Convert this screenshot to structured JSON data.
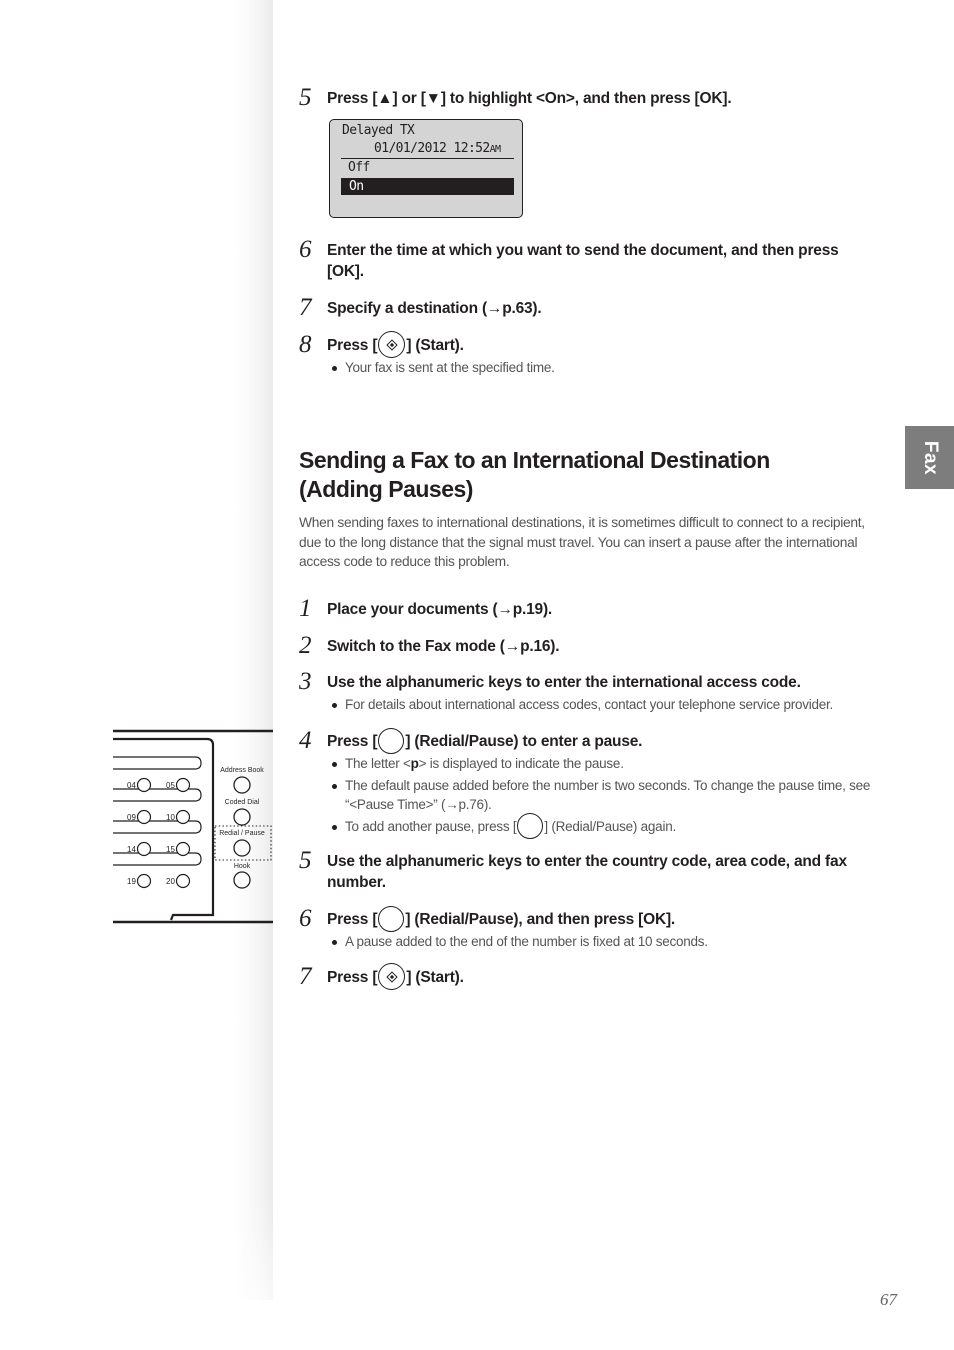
{
  "document": {
    "page_number": "67",
    "side_tab_label": "Fax",
    "colors": {
      "text": "#231f20",
      "body_text": "#555555",
      "tab": "#7d7d7d",
      "lcd_bg": "#d4d4d4"
    }
  },
  "first_steps": [
    {
      "num": "5",
      "text": "Press [▲] or [▼] to highlight <On>, and then press [OK].",
      "bullets": []
    },
    {
      "num": "6",
      "text": "Enter the time at which you want to send the document, and then press [OK].",
      "bullets": []
    },
    {
      "num": "7",
      "text": "Specify a destination (→p.63).",
      "bullets": []
    },
    {
      "num": "8",
      "text_before": "Press [",
      "text_after": "] (Start).",
      "icon": "start-button-icon",
      "bullets": [
        "Your fax is sent at the specified time."
      ]
    }
  ],
  "lcd": {
    "line1": "Delayed TX",
    "line2": "01/01/2012 12:52",
    "line2_suffix": "AM",
    "option_off": "Off",
    "option_on": "On",
    "selected": "On"
  },
  "section": {
    "title": "Sending a Fax to an International Destination (Adding Pauses)",
    "intro": "When sending faxes to international destinations, it is sometimes difficult to connect to a recipient, due to the long distance that the signal must travel. You can insert a pause after the international access code to reduce this problem."
  },
  "steps": [
    {
      "num": "1",
      "text": "Place your documents (→p.19)."
    },
    {
      "num": "2",
      "text": "Switch to the Fax mode (→p.16)."
    },
    {
      "num": "3",
      "text": "Use the alphanumeric keys to enter the international access code.",
      "bullets": [
        "For details about international access codes, contact your telephone service provider."
      ]
    },
    {
      "num": "4",
      "text_before": "Press [",
      "text_after": "] (Redial/Pause) to enter a pause.",
      "icon": "redial-pause-button-icon",
      "bullets": [
        {
          "before": "The letter <",
          "bold": "p",
          "after": "> is displayed to indicate the pause."
        },
        "The default pause added before the number is two seconds. To change the pause time, see “<Pause Time>” (→p.76).",
        {
          "before": "To add another pause, press [",
          "after": "] (Redial/Pause) again."
        }
      ]
    },
    {
      "num": "5",
      "text": "Use the alphanumeric keys to enter the country code, area code, and fax number."
    },
    {
      "num": "6",
      "text_before": "Press [",
      "text_after": "] (Redial/Pause), and then press [OK].",
      "icon": "redial-pause-button-icon",
      "bullets": [
        "A pause added to the end of the number is fixed at 10 seconds."
      ]
    },
    {
      "num": "7",
      "text_before": "Press [",
      "text_after": "] (Start).",
      "icon": "start-button-icon"
    }
  ],
  "panel": {
    "keys": [
      "04",
      "05",
      "09",
      "10",
      "14",
      "15",
      "19",
      "20"
    ],
    "labels": [
      "Address Book",
      "Coded Dial",
      "Redial / Pause",
      "Hook"
    ],
    "highlighted": "Redial / Pause"
  }
}
